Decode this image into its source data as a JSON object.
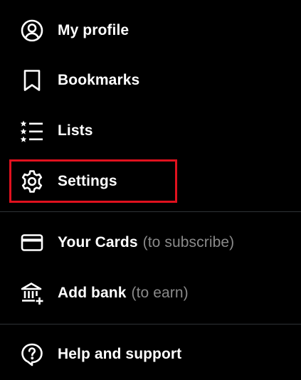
{
  "menu": {
    "items": [
      {
        "label": "My profile",
        "hint": "",
        "icon": "profile-icon"
      },
      {
        "label": "Bookmarks",
        "hint": "",
        "icon": "bookmark-icon"
      },
      {
        "label": "Lists",
        "hint": "",
        "icon": "lists-icon"
      },
      {
        "label": "Settings",
        "hint": "",
        "icon": "gear-icon"
      },
      {
        "label": "Your Cards",
        "hint": "(to subscribe)",
        "icon": "card-icon"
      },
      {
        "label": "Add bank",
        "hint": "(to earn)",
        "icon": "bank-icon"
      },
      {
        "label": "Help and support",
        "hint": "",
        "icon": "help-icon"
      }
    ]
  },
  "colors": {
    "background": "#000000",
    "text": "#ffffff",
    "hint_text": "#8a8a8a",
    "divider": "#2f3336",
    "highlight": "#e0111e"
  }
}
